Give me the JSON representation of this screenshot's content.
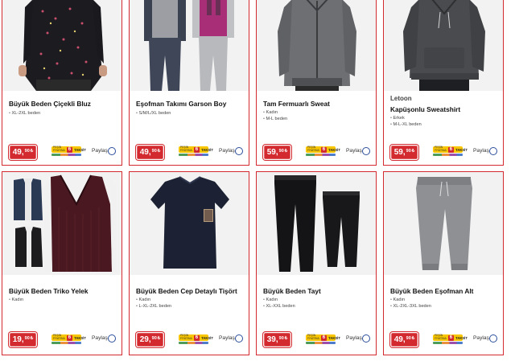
{
  "products": [
    {
      "title": "Büyük Beden Çiçekli Bluz",
      "brand": "",
      "details": [
        "XL-2XL beden"
      ],
      "price_int": "49",
      "price_dec": "90",
      "currency": "₺",
      "image": "floral-blouse"
    },
    {
      "title": "Eşofman Takımı Garson Boy",
      "brand": "",
      "details": [
        "S/M/L/XL beden"
      ],
      "price_int": "49",
      "price_dec": "90",
      "currency": "₺",
      "image": "tracksuit-set"
    },
    {
      "title": "Tam Fermuarlı Sweat",
      "brand": "",
      "details": [
        "Kadın",
        "M-L beden"
      ],
      "price_int": "59",
      "price_dec": "90",
      "currency": "₺",
      "image": "zip-sweat"
    },
    {
      "title": "Kapüşonlu Sweatshirt",
      "brand": "Letoon",
      "details": [
        "Erkek",
        "M-L-XL beden"
      ],
      "price_int": "59",
      "price_dec": "90",
      "currency": "₺",
      "image": "hoodie"
    },
    {
      "title": "Büyük Beden Triko Yelek",
      "brand": "",
      "details": [
        "Kadın"
      ],
      "price_int": "19",
      "price_dec": "90",
      "currency": "₺",
      "image": "knit-vest"
    },
    {
      "title": "Büyük Beden Cep Detaylı Tişört",
      "brand": "",
      "details": [
        "Kadın",
        "L-XL-2XL beden"
      ],
      "price_int": "29",
      "price_dec": "90",
      "currency": "₺",
      "image": "pocket-tshirt"
    },
    {
      "title": "Büyük Beden Tayt",
      "brand": "",
      "details": [
        "Kadın",
        "XL-XXL beden"
      ],
      "price_int": "39",
      "price_dec": "90",
      "currency": "₺",
      "image": "leggings"
    },
    {
      "title": "Büyük Beden Eşofman Alt",
      "brand": "",
      "details": [
        "Kadın",
        "XL-2XL-3XL beden"
      ],
      "price_int": "49",
      "price_dec": "90",
      "currency": "₺",
      "image": "jogger-pants"
    }
  ],
  "installment": {
    "number": "6",
    "word": "TAKSİT",
    "prefix": "PEŞİN FİYATINA"
  },
  "share_label": "Paylaş",
  "colors": {
    "accent": "#d32a2f",
    "card_border": "#d32a2f",
    "installment_bar": "#f7c600",
    "share_ring": "#2b4d9c"
  }
}
